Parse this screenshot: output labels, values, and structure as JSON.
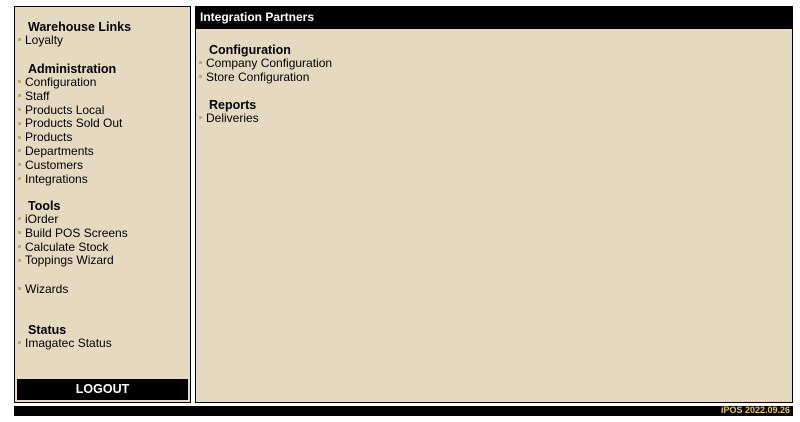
{
  "sidebar": {
    "warehouse": {
      "title": "Warehouse Links",
      "items": [
        "Loyalty"
      ]
    },
    "administration": {
      "title": "Administration",
      "items": [
        "Configuration",
        "Staff",
        "Products Local",
        "Products Sold Out",
        "Products",
        "Departments",
        "Customers",
        "Integrations"
      ]
    },
    "tools": {
      "title": "Tools",
      "items": [
        "iOrder",
        "Build POS Screens",
        "Calculate Stock",
        "Toppings Wizard"
      ]
    },
    "wizards": {
      "items": [
        "Wizards"
      ]
    },
    "status": {
      "title": "Status",
      "items": [
        "Imagatec Status"
      ]
    },
    "logout_label": "LOGOUT"
  },
  "main": {
    "header": "Integration Partners",
    "configuration": {
      "title": "Configuration",
      "items": [
        "Company Configuration",
        "Store Configuration"
      ]
    },
    "reports": {
      "title": "Reports",
      "items": [
        "Deliveries"
      ]
    }
  },
  "footer": {
    "version": "iPOS 2022.09.26"
  },
  "colors": {
    "panel_bg": "#e5d9c0",
    "header_bg": "#000000",
    "bullet": "#c9a667",
    "version_text": "#f2c94c"
  }
}
